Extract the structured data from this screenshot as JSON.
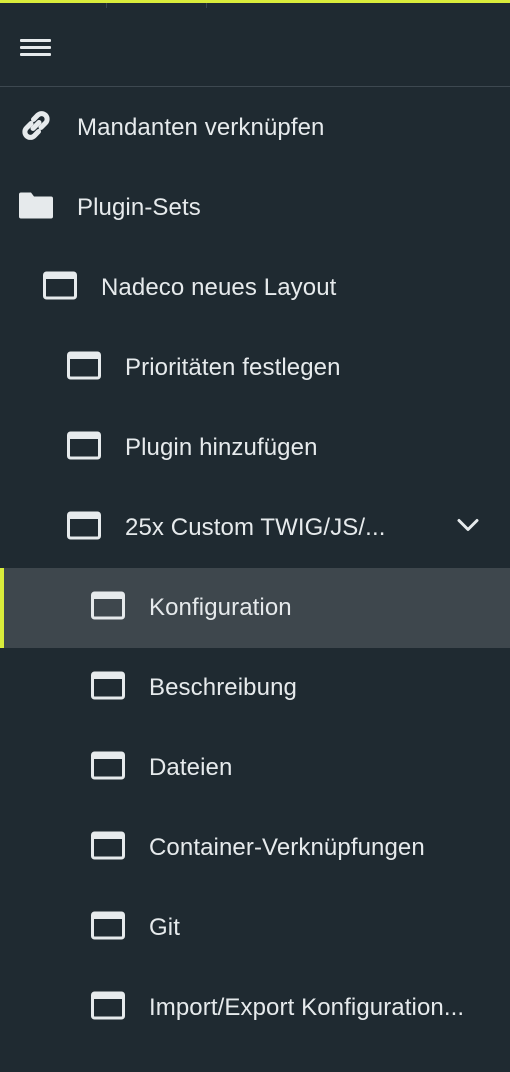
{
  "menu": {
    "hamburger_icon": "menu-icon"
  },
  "nav": {
    "items": [
      {
        "label": "Mandanten verknüpfen",
        "icon": "link-icon"
      },
      {
        "label": "Plugin-Sets",
        "icon": "folder-icon"
      },
      {
        "label": "Nadeco neues Layout",
        "icon": "window-icon"
      },
      {
        "label": "Prioritäten festlegen",
        "icon": "window-icon"
      },
      {
        "label": "Plugin hinzufügen",
        "icon": "window-icon"
      },
      {
        "label": "25x Custom TWIG/JS/...",
        "icon": "window-icon",
        "expand_icon": "chevron-down-icon"
      },
      {
        "label": "Konfiguration",
        "icon": "window-icon",
        "active": true
      },
      {
        "label": "Beschreibung",
        "icon": "window-icon"
      },
      {
        "label": "Dateien",
        "icon": "window-icon"
      },
      {
        "label": "Container-Verknüpfungen",
        "icon": "window-icon"
      },
      {
        "label": "Git",
        "icon": "window-icon"
      },
      {
        "label": "Import/Export Konfiguration...",
        "icon": "window-icon"
      }
    ]
  },
  "colors": {
    "background": "#1f2a31",
    "active_background": "#3e474d",
    "accent": "#d9ec3b",
    "text": "#e6eaec"
  }
}
